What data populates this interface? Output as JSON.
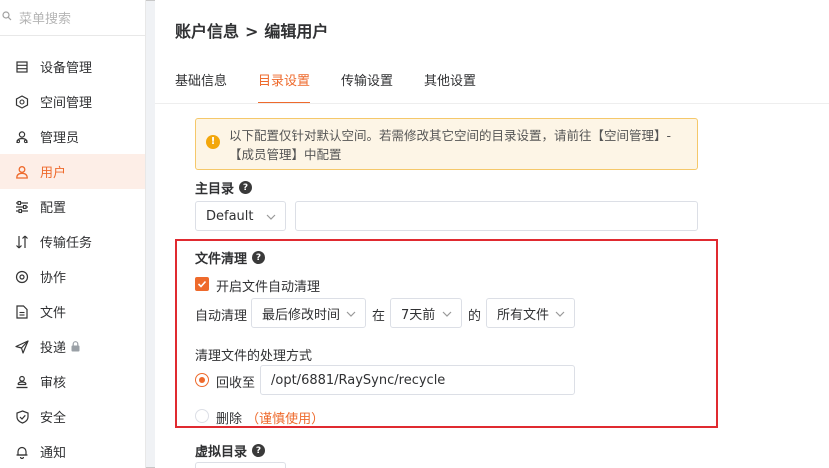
{
  "sidebar": {
    "search_placeholder": "菜单搜索",
    "items": [
      {
        "label": "设备管理",
        "icon": "server-icon"
      },
      {
        "label": "空间管理",
        "icon": "space-icon"
      },
      {
        "label": "管理员",
        "icon": "admin-icon"
      },
      {
        "label": "用户",
        "icon": "user-icon",
        "active": true
      },
      {
        "label": "配置",
        "icon": "sliders-icon"
      },
      {
        "label": "传输任务",
        "icon": "transfer-icon"
      },
      {
        "label": "协作",
        "icon": "collaborate-icon"
      },
      {
        "label": "文件",
        "icon": "file-icon"
      },
      {
        "label": "投递",
        "icon": "send-icon",
        "locked": true
      },
      {
        "label": "审核",
        "icon": "audit-icon"
      },
      {
        "label": "安全",
        "icon": "shield-icon"
      },
      {
        "label": "通知",
        "icon": "bell-icon"
      }
    ]
  },
  "breadcrumb": {
    "parent": "账户信息",
    "separator": ">",
    "current": "编辑用户"
  },
  "tabs": [
    {
      "label": "基础信息"
    },
    {
      "label": "目录设置",
      "active": true
    },
    {
      "label": "传输设置"
    },
    {
      "label": "其他设置"
    }
  ],
  "notice": {
    "text": "以下配置仅针对默认空间。若需修改其它空间的目录设置，请前往【空间管理】-【成员管理】中配置"
  },
  "main_dir": {
    "label": "主目录",
    "select_value": "Default",
    "path_value": ""
  },
  "cleanup": {
    "label": "文件清理",
    "enable_label": "开启文件自动清理",
    "enabled": true,
    "auto_label": "自动清理",
    "time_field": "最后修改时间",
    "in_label": "在",
    "period": "7天前",
    "of_label": "的",
    "file_scope": "所有文件",
    "method_label": "清理文件的处理方式",
    "recycle_label": "回收至",
    "recycle_path": "/opt/6881/RaySync/recycle",
    "delete_label": "删除",
    "delete_caution": "（谨慎使用）"
  },
  "virtual_dir": {
    "label": "虚拟目录"
  },
  "colors": {
    "accent": "#ee6a2c",
    "highlight_box": "#e02a30",
    "warning": "#f3a70c"
  }
}
